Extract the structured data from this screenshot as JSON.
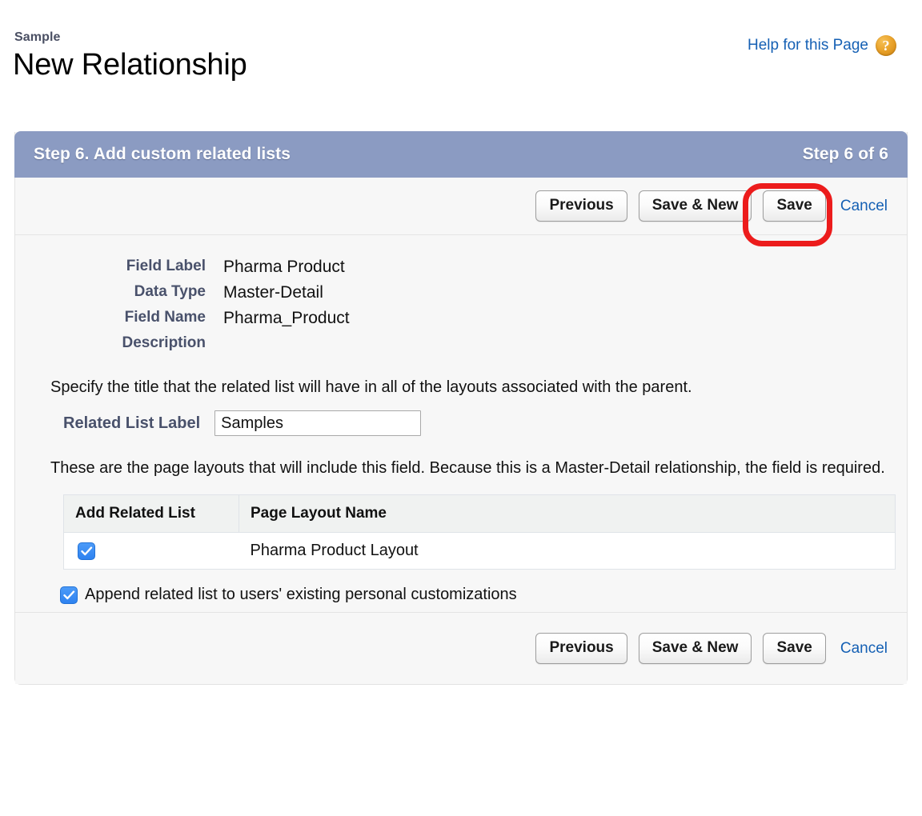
{
  "header": {
    "breadcrumb": "Sample",
    "title": "New Relationship",
    "help_link": "Help for this Page",
    "help_icon": "question-mark-circle-icon"
  },
  "panel": {
    "step_title": "Step 6. Add custom related lists",
    "step_counter": "Step 6 of 6",
    "accent_color": "#8b9bc2"
  },
  "toolbar": {
    "previous_label": "Previous",
    "save_new_label": "Save & New",
    "save_label": "Save",
    "cancel_label": "Cancel"
  },
  "fields": [
    {
      "label": "Field Label",
      "value": "Pharma Product"
    },
    {
      "label": "Data Type",
      "value": "Master-Detail"
    },
    {
      "label": "Field Name",
      "value": "Pharma_Product"
    },
    {
      "label": "Description",
      "value": ""
    }
  ],
  "related_list": {
    "instruction": "Specify the title that the related list will have in all of the layouts associated with the parent.",
    "label": "Related List Label",
    "value": "Samples",
    "placeholder": ""
  },
  "layouts": {
    "instruction": "These are the page layouts that will include this field. Because this is a Master-Detail relationship, the field is required.",
    "columns": [
      "Add Related List",
      "Page Layout Name"
    ],
    "rows": [
      {
        "checked": true,
        "name": "Pharma Product Layout"
      }
    ]
  },
  "append_option": {
    "label": "Append related list to users' existing personal customizations",
    "checked": true
  },
  "annotation": {
    "target": "save-button-top",
    "color": "#ec1c1c",
    "shape": "rounded-rectangle-outline"
  }
}
